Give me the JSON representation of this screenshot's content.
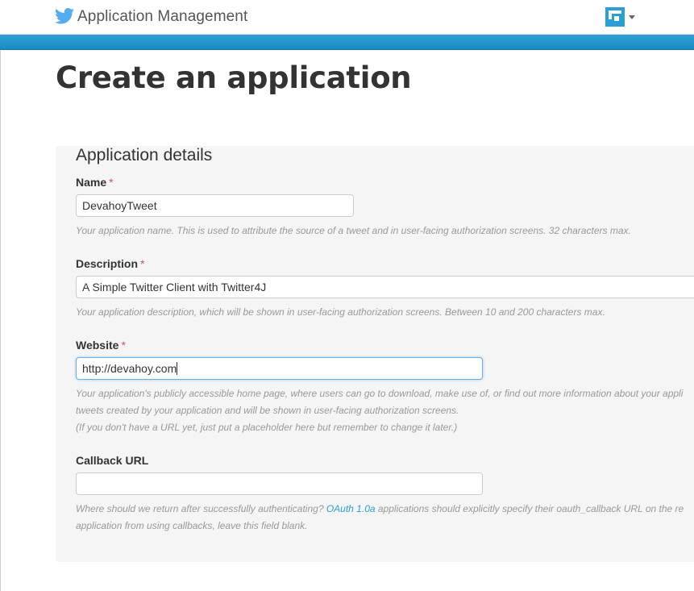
{
  "header": {
    "app_title": "Application Management",
    "bird_icon": "twitter-bird-icon",
    "account_icon": "account-logo-icon",
    "accent_color": "#55acee",
    "bar_color": "#2c9fd6"
  },
  "page": {
    "title": "Create an application"
  },
  "form": {
    "section_title": "Application details",
    "required_marker": "*",
    "name": {
      "label": "Name",
      "value": "DevahoyTweet",
      "help": "Your application name. This is used to attribute the source of a tweet and in user-facing authorization screens. 32 characters max."
    },
    "description": {
      "label": "Description",
      "value": "A Simple Twitter Client with Twitter4J",
      "help": "Your application description, which will be shown in user-facing authorization screens. Between 10 and 200 characters max."
    },
    "website": {
      "label": "Website",
      "value": "http://devahoy.com",
      "help_line1": "Your application's publicly accessible home page, where users can go to download, make use of, or find out more information about your appli",
      "help_line2": "tweets created by your application and will be shown in user-facing authorization screens.",
      "help_line3": "(If you don't have a URL yet, just put a placeholder here but remember to change it later.)"
    },
    "callback": {
      "label": "Callback URL",
      "value": "",
      "help_prefix": "Where should we return after successfully authenticating? ",
      "help_link": "OAuth 1.0a",
      "help_suffix": " applications should explicitly specify their oauth_callback URL on the re",
      "help_line2": "application from using callbacks, leave this field blank."
    }
  }
}
